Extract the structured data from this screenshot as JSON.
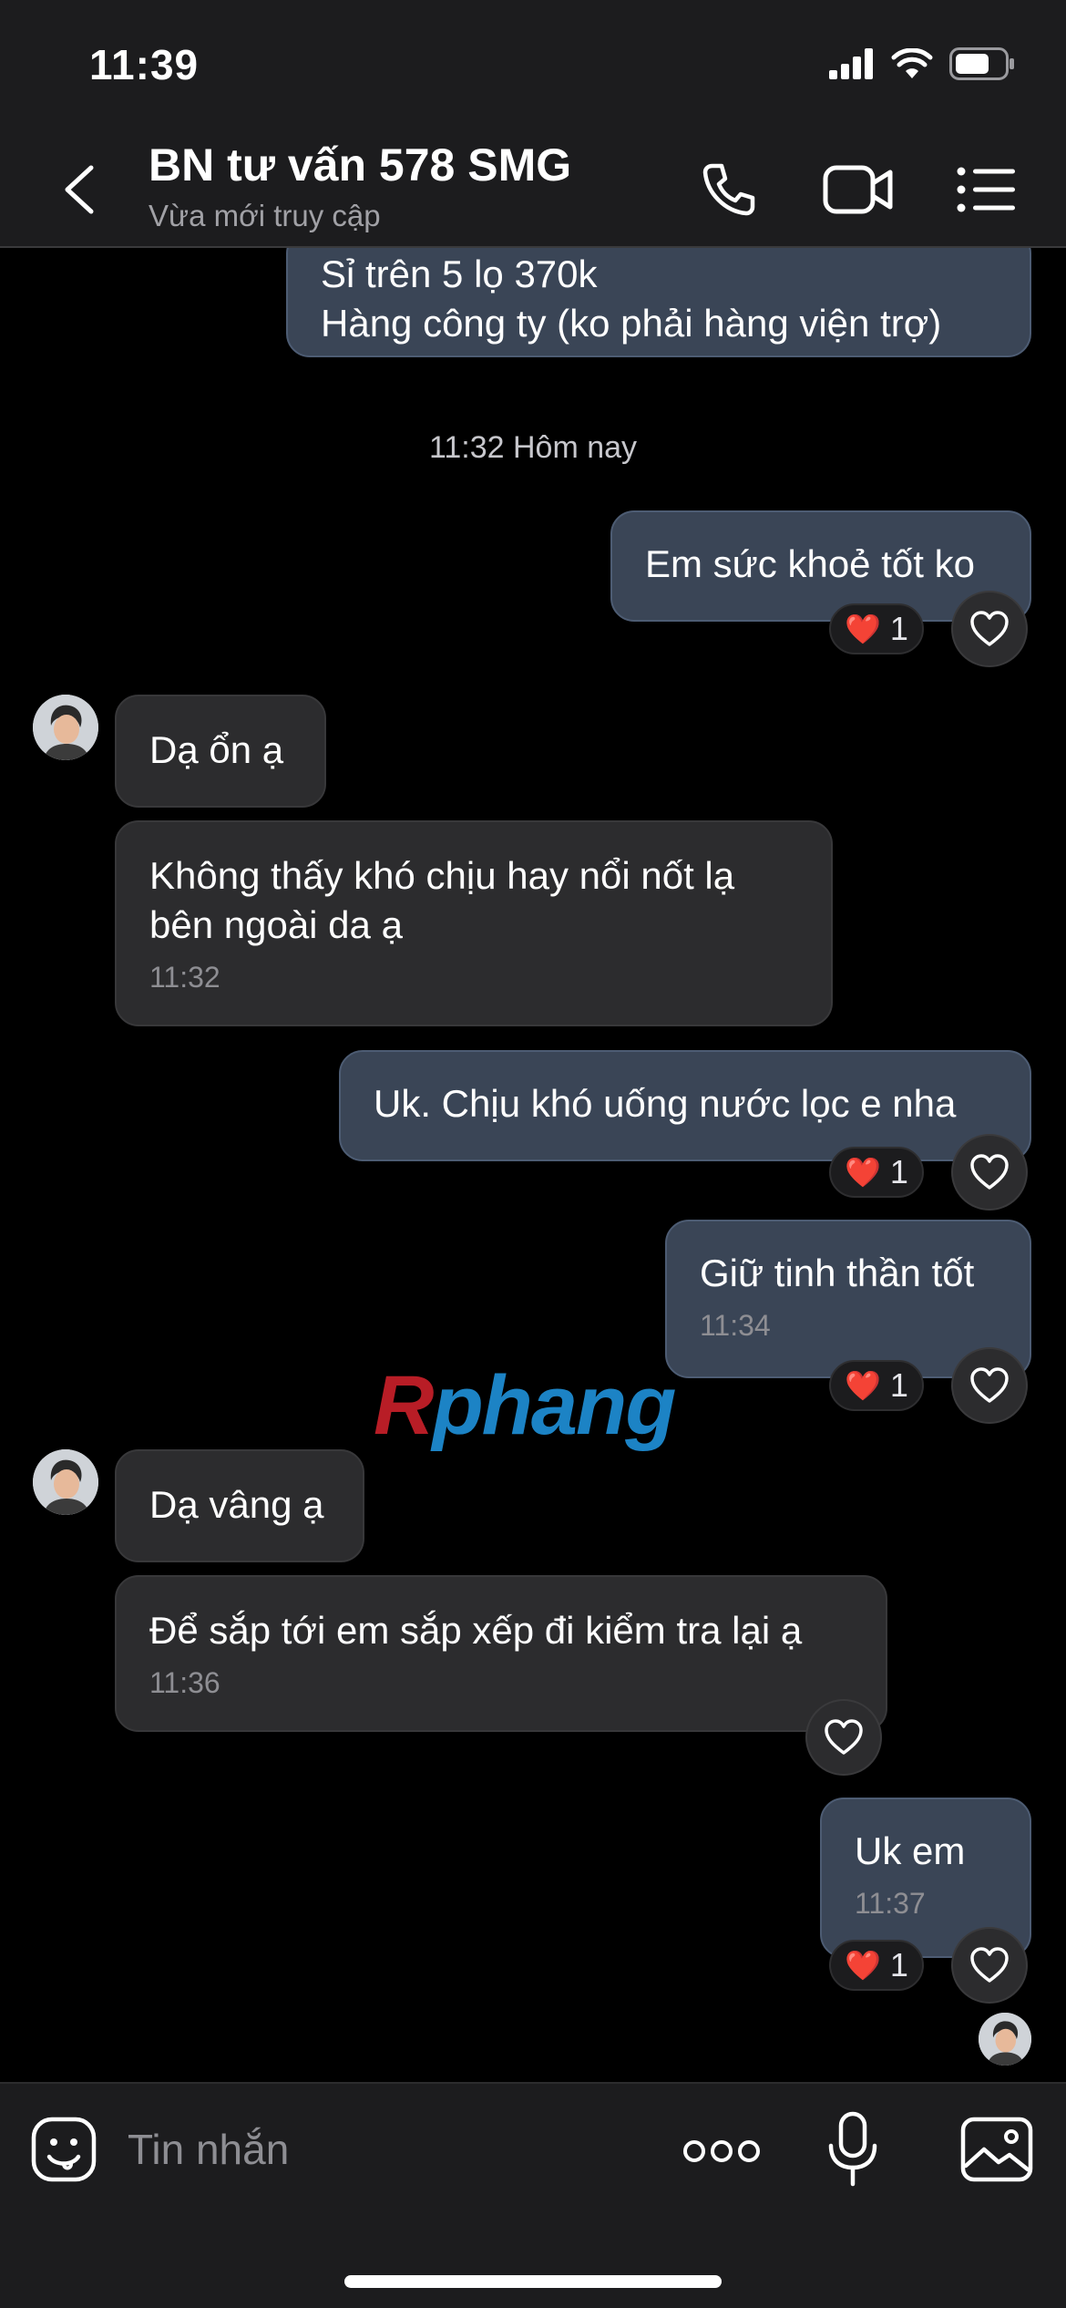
{
  "status_bar": {
    "time": "11:39"
  },
  "header": {
    "title": "BN tư vấn 578 SMG",
    "subtitle": "Vừa mới truy cập"
  },
  "messages": [
    {
      "direction": "outgoing",
      "text": "Sỉ trên 5 lọ 370k\nHàng công ty (ko phải hàng viện trợ)"
    },
    {
      "direction": "outgoing",
      "text": "Em sức khoẻ tốt ko",
      "reaction": {
        "emoji": "❤️",
        "count": "1"
      }
    },
    {
      "direction": "incoming",
      "text": "Dạ ổn ạ"
    },
    {
      "direction": "incoming",
      "text": "Không thấy khó chịu hay nổi nốt lạ\nbên ngoài da ạ",
      "time": "11:32"
    },
    {
      "direction": "outgoing",
      "text": "Uk. Chịu khó uống nước lọc e nha",
      "reaction": {
        "emoji": "❤️",
        "count": "1"
      }
    },
    {
      "direction": "outgoing",
      "text": "Giữ tinh thần tốt",
      "time": "11:34",
      "reaction": {
        "emoji": "❤️",
        "count": "1"
      }
    },
    {
      "direction": "incoming",
      "text": "Dạ vâng ạ"
    },
    {
      "direction": "incoming",
      "text": "Để sắp tới em sắp xếp đi kiểm tra lại ạ",
      "time": "11:36"
    },
    {
      "direction": "outgoing",
      "text": "Uk em",
      "time": "11:37",
      "reaction": {
        "emoji": "❤️",
        "count": "1"
      }
    }
  ],
  "date_separator": "11:32 Hôm nay",
  "watermark": {
    "part1": "R",
    "part2": "phang"
  },
  "composer": {
    "placeholder": "Tin nhắn"
  },
  "colors": {
    "outgoing_bubble": "#3a4556",
    "incoming_bubble": "#2c2c2e",
    "background": "#000000",
    "bar": "#1c1c1e"
  }
}
